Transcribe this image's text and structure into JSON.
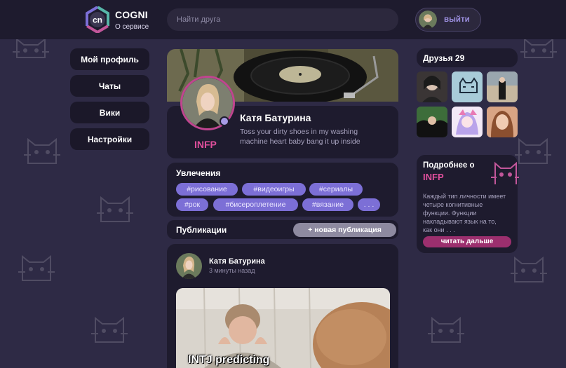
{
  "header": {
    "brand_name": "COGNI",
    "logo_text": "cn",
    "about_link": "О сервисе",
    "search_placeholder": "Найти друга",
    "logout_label": "выйти"
  },
  "nav": {
    "items": [
      {
        "label": "Мой профиль"
      },
      {
        "label": "Чаты"
      },
      {
        "label": "Вики"
      },
      {
        "label": "Настройки"
      }
    ]
  },
  "profile": {
    "name": "Катя Батурина",
    "bio": "Toss your dirty shoes in my washing machine heart baby bang it up inside",
    "mbti": "INFP"
  },
  "interests": {
    "title": "Увлечения",
    "tags": [
      "#рисование",
      "#видеоигры",
      "#сериалы",
      "#рок",
      "#бисероплетение",
      "#вязание",
      ". . ."
    ]
  },
  "publications": {
    "title": "Публикации",
    "new_button": "+ новая публикация"
  },
  "post": {
    "author": "Катя Батурина",
    "time": "3 минуты назад",
    "caption": "INTJ predicting"
  },
  "friends": {
    "title": "Друзья 29"
  },
  "more": {
    "title": "Подробнее  о",
    "type": "INFP",
    "text": "Каждый тип личности имеет четыре когнитивные функции. Функции накладывают язык на то, как они . . .",
    "read_more": "читать дальше"
  },
  "colors": {
    "background": "#2e2a45",
    "card": "#1e1b2e",
    "accent_pink": "#e04f9c",
    "tag_purple": "#7c6fd6",
    "read_more_button": "#9c2f6e"
  }
}
